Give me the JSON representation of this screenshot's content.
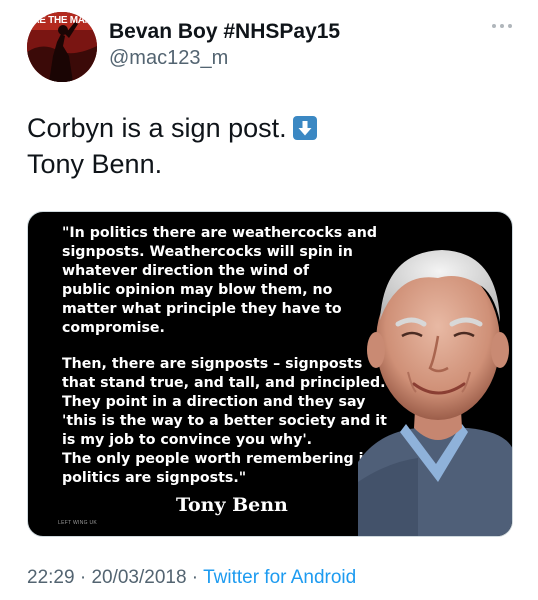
{
  "author": {
    "display_name": "Bevan Boy #NHSPay15",
    "handle": "@mac123_m",
    "avatar_text": "AE THE MAN"
  },
  "tweet": {
    "text_lines": [
      "Corbyn is a sign post.",
      "Tony Benn."
    ],
    "emoji": "down-arrow-emoji"
  },
  "media": {
    "quote_lines_1": [
      "\"In politics there are weathercocks and",
      "signposts. Weathercocks will spin in",
      "whatever direction the wind of",
      "public opinion may blow them, no",
      "matter what principle they have to",
      "compromise."
    ],
    "quote_lines_2": [
      "Then, there are signposts – signposts",
      "that stand true, and tall, and principled.",
      "They point in a direction and they say",
      "'this is the way to a better society and it",
      "is my job to convince you why'.",
      "The only people worth remembering in",
      "politics are signposts.\""
    ],
    "attribution": "Tony Benn",
    "watermark": "LEFT WING UK"
  },
  "meta": {
    "time": "22:29",
    "separator": " · ",
    "date": "20/03/2018",
    "source": "Twitter for Android"
  },
  "colors": {
    "text": "#0f1419",
    "secondary": "#536471",
    "link": "#1d9bf0",
    "emoji_bg": "#3b88c3"
  },
  "icons": [
    "more-icon",
    "down-arrow-emoji"
  ]
}
